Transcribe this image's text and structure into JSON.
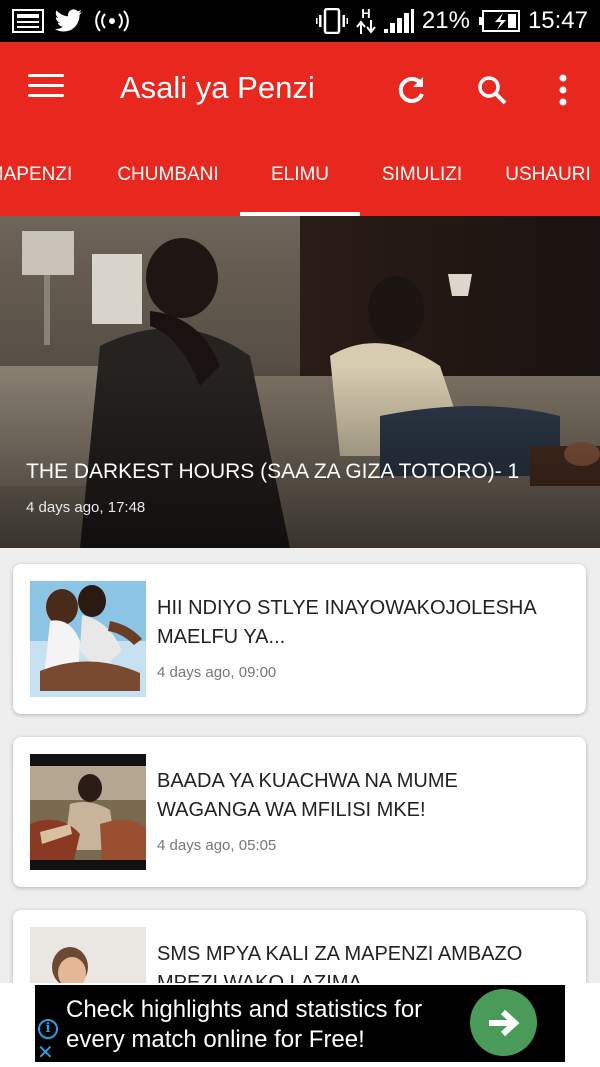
{
  "status_bar": {
    "battery": "21%",
    "time": "15:47",
    "network_type": "H",
    "icons": [
      "image-icon",
      "twitter-icon",
      "broadcast-icon",
      "vibrate-icon",
      "data-arrows-icon",
      "signal-icon",
      "battery-charging-icon"
    ]
  },
  "app_bar": {
    "title": "Asali ya Penzi",
    "background_color": "#e8281e",
    "icons": [
      "menu-icon",
      "refresh-icon",
      "search-icon",
      "more-vert-icon"
    ]
  },
  "tabs": {
    "items": [
      "MAPENZI",
      "CHUMBANI",
      "ELIMU",
      "SIMULIZI",
      "USHAURI"
    ],
    "active": "ELIMU"
  },
  "featured": {
    "title": "THE DARKEST HOURS (SAA ZA GIZA TOTORO)- 1",
    "date": "4 days ago, 17:48"
  },
  "articles": [
    {
      "title": "HII NDIYO STLYE INAYOWAKOJOLESHA MAELFU YA...",
      "date": "4 days ago, 09:00"
    },
    {
      "title": "BAADA YA KUACHWA NA MUME WAGANGA WA MFILISI MKE!",
      "date": "4 days ago, 05:05"
    },
    {
      "title": "SMS MPYA KALI ZA MAPENZI AMBAZO MPEZI WAKO LAZIMA"
    }
  ],
  "ad": {
    "text": "Check highlights and statistics for every match online for Free!",
    "button_color": "#4a9a5a",
    "icons": [
      "ad-info-icon",
      "ad-close-icon",
      "arrow-right-icon"
    ]
  }
}
